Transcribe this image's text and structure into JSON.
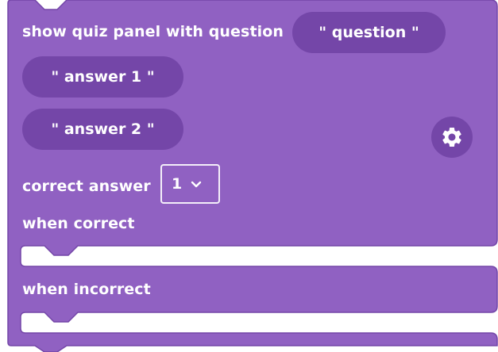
{
  "block": {
    "title": "show quiz panel with question",
    "question_value": "\" question \"",
    "answer1_value": "\" answer 1 \"",
    "answer2_value": "\" answer 2 \"",
    "correct_answer_label": "correct answer",
    "correct_answer_value": "1",
    "when_correct_label": "when correct",
    "when_incorrect_label": "when incorrect"
  },
  "icons": {
    "settings": "gear-icon",
    "dropdown": "chevron-down-icon"
  },
  "colors": {
    "block_fill": "#9061C2",
    "block_border": "#7446A8",
    "input_fill": "#7446A8",
    "gear_bg": "#7446A8",
    "text": "#FFFFFF",
    "page": "#FFFFFF"
  }
}
